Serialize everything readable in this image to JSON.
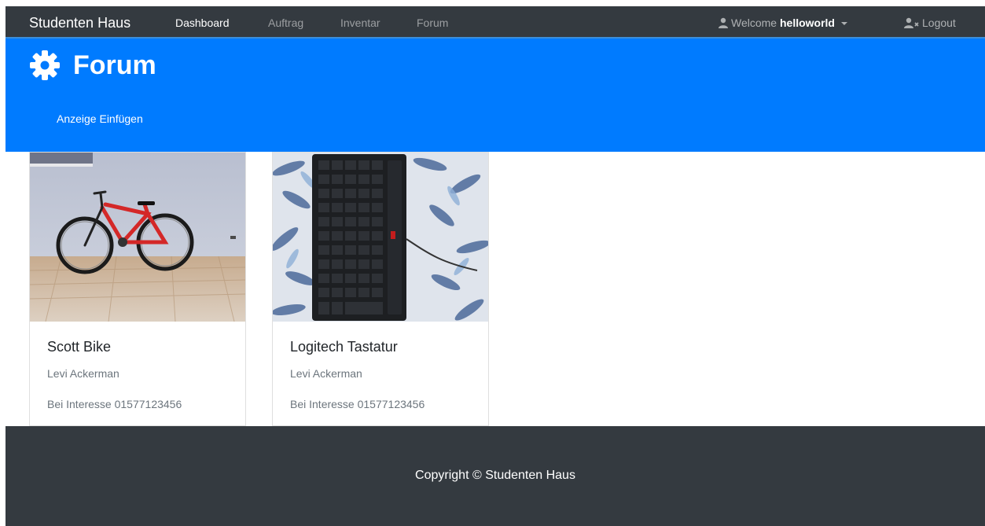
{
  "navbar": {
    "brand": "Studenten Haus",
    "links": [
      {
        "label": "Dashboard",
        "active": true
      },
      {
        "label": "Auftrag",
        "active": false
      },
      {
        "label": "Inventar",
        "active": false
      },
      {
        "label": "Forum",
        "active": false
      }
    ],
    "welcome_prefix": "Welcome",
    "username": "helloworld",
    "user_icon": "user-icon",
    "logout_label": "Logout",
    "logout_icon": "user-x-icon"
  },
  "header": {
    "title": "Forum",
    "icon": "gear-icon",
    "insert_link": "Anzeige Einfügen",
    "background": "#007bff"
  },
  "cards": [
    {
      "title": "Scott Bike",
      "owner": "Levi Ackerman",
      "contact": "Bei Interesse 01577123456",
      "image": "red mountain bike leaning against wall"
    },
    {
      "title": "Logitech Tastatur",
      "owner": "Levi Ackerman",
      "contact": "Bei Interesse 01577123456",
      "image": "black keyboard on patterned blanket"
    }
  ],
  "footer": {
    "copyright": "Copyright © Studenten Haus"
  },
  "colors": {
    "navbar": "#343a40",
    "accent": "#007bff",
    "footer": "#343a40"
  }
}
